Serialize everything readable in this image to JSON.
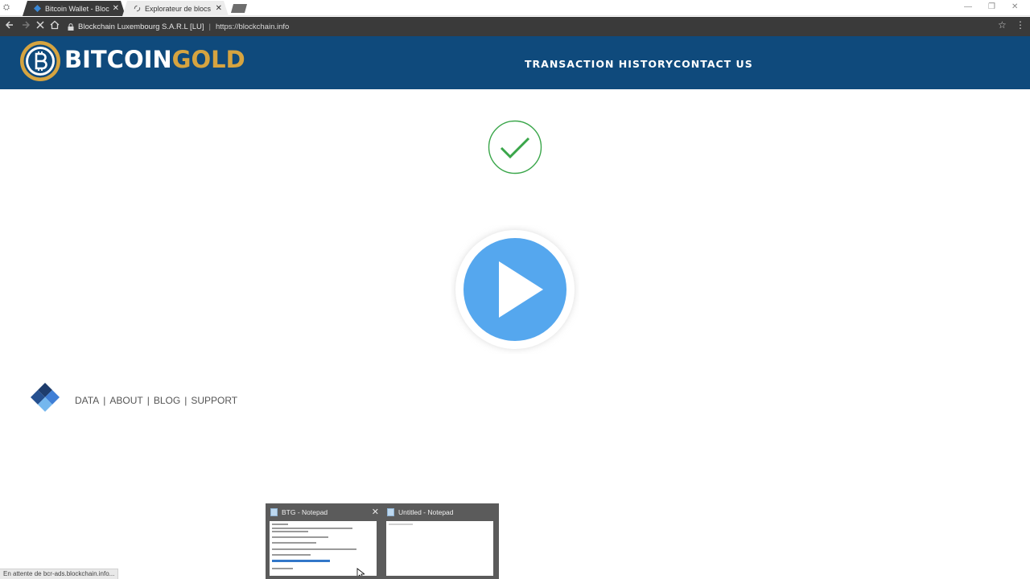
{
  "browser": {
    "tabs": [
      {
        "title": "Bitcoin Wallet - Blockchain",
        "active": true
      },
      {
        "title": "Explorateur de blocs Bitcoin",
        "active": false
      }
    ],
    "address": {
      "organization": "Blockchain Luxembourg S.A.R.L [LU]",
      "url": "https://blockchain.info"
    },
    "status_text": "En attente de bcr-ads.blockchain.info..."
  },
  "header": {
    "brand_part1": "BITCOIN",
    "brand_part2": "GOLD",
    "nav": [
      {
        "label": "TRANSACTION HISTORY"
      },
      {
        "label": "CONTACT US"
      }
    ]
  },
  "footer": {
    "links": [
      {
        "label": "DATA"
      },
      {
        "label": "ABOUT"
      },
      {
        "label": "BLOG"
      },
      {
        "label": "SUPPORT"
      }
    ],
    "separator": "|"
  },
  "taskbar_thumbnails": [
    {
      "title": "BTG - Notepad"
    },
    {
      "title": "Untitled - Notepad"
    }
  ],
  "colors": {
    "header_bg": "#0f4a7c",
    "gold": "#d6a440",
    "play_blue": "#55a7ee",
    "check_green": "#3aa64a"
  },
  "icons": {
    "check": "checkmark-circle-icon",
    "play": "play-button-icon",
    "footer_logo": "blockchain-diamond-icon"
  }
}
